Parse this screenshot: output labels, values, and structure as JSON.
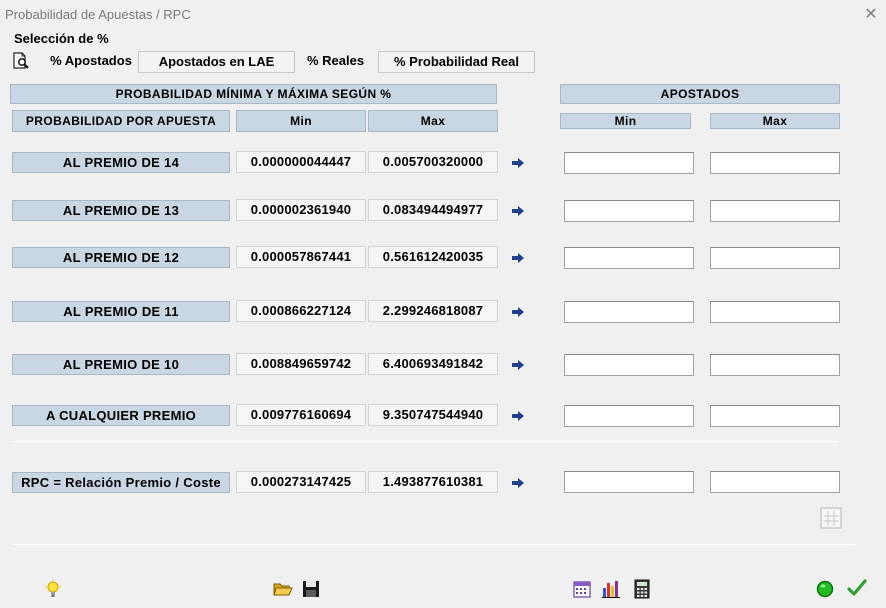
{
  "window": {
    "title": "Probabilidad de Apuestas / RPC",
    "close_glyph": "✕"
  },
  "selection": {
    "label": "Selección de %",
    "modes": [
      "% Apostados",
      "Apostados en LAE",
      "% Reales",
      "% Probabilidad Real"
    ]
  },
  "headers": {
    "range": "PROBABILIDAD MÍNIMA Y MÁXIMA SEGÚN %",
    "per_bet": "PROBABILIDAD POR APUESTA",
    "min": "Min",
    "max": "Max",
    "bet": "APOSTADOS",
    "bet_min": "Min",
    "bet_max": "Max"
  },
  "rows": [
    {
      "label": "AL PREMIO DE 14",
      "min": "0.000000044447",
      "max": "0.005700320000",
      "bet_min": "",
      "bet_max": ""
    },
    {
      "label": "AL PREMIO DE 13",
      "min": "0.000002361940",
      "max": "0.083494494977",
      "bet_min": "",
      "bet_max": ""
    },
    {
      "label": "AL PREMIO DE 12",
      "min": "0.000057867441",
      "max": "0.561612420035",
      "bet_min": "",
      "bet_max": ""
    },
    {
      "label": "AL PREMIO DE 11",
      "min": "0.000866227124",
      "max": "2.299246818087",
      "bet_min": "",
      "bet_max": ""
    },
    {
      "label": "AL PREMIO DE 10",
      "min": "0.008849659742",
      "max": "6.400693491842",
      "bet_min": "",
      "bet_max": ""
    },
    {
      "label": "A CUALQUIER PREMIO",
      "min": "0.009776160694",
      "max": "9.350747544940",
      "bet_min": "",
      "bet_max": ""
    }
  ],
  "rpc": {
    "label": "RPC = Relación Premio / Coste",
    "min": "0.000273147425",
    "max": "1.493877610381",
    "bet_min": "",
    "bet_max": ""
  },
  "icons": {
    "preview": "magnifier-page-icon",
    "arrow": "arrow-right-icon",
    "grid": "grid-icon",
    "hint": "lightbulb-icon",
    "open": "open-folder-icon",
    "save": "save-disk-icon",
    "calendar": "calendar-icon",
    "chart": "bar-chart-icon",
    "calculator": "calculator-icon",
    "status": "green-circle-icon",
    "ok": "checkmark-icon"
  },
  "colors": {
    "header_bg": "#c9d7e5",
    "arrow": "#1f3f8f",
    "ok": "#2f9e2f",
    "status": "#22bb22"
  }
}
